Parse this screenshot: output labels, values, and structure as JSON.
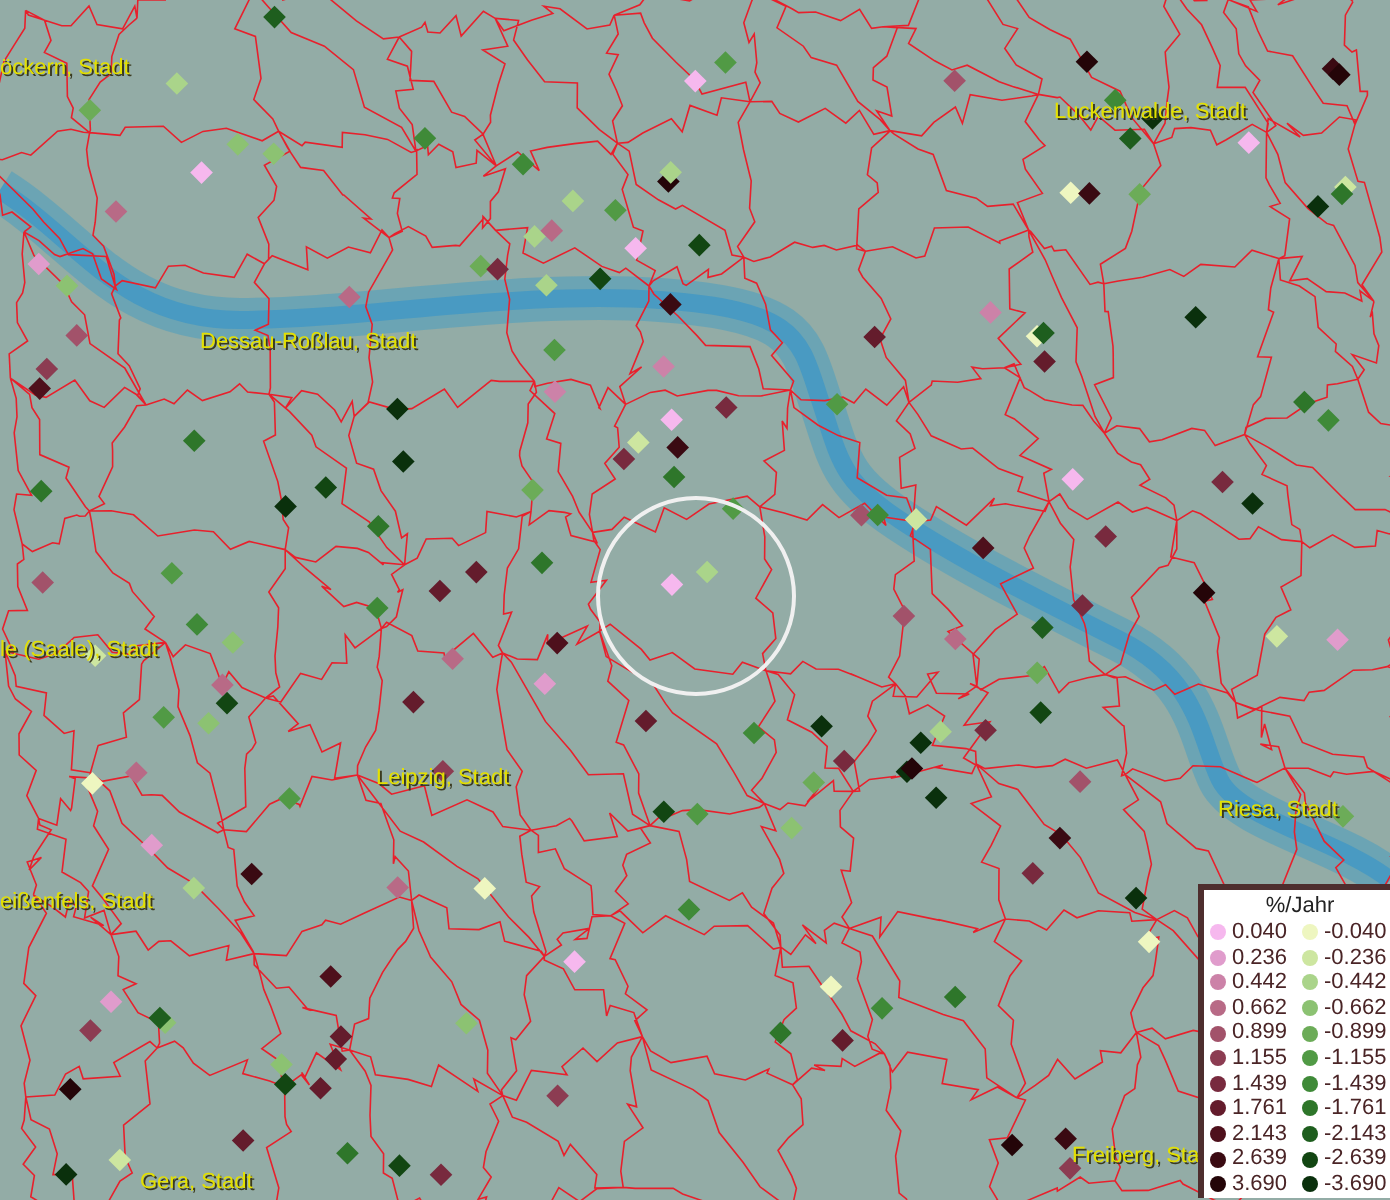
{
  "map": {
    "place_labels": [
      {
        "text": "öckern, Stadt"
      },
      {
        "text": "Luckenwalde, Stadt"
      },
      {
        "text": "Dessau-Roßlau, Stadt"
      },
      {
        "text": "le (Saale), Stadt"
      },
      {
        "text": "Leipzig, Stadt"
      },
      {
        "text": "eißenfels, Stadt"
      },
      {
        "text": "Riesa, Stadt"
      },
      {
        "text": "Freiberg, Sta"
      },
      {
        "text": "Gera, Stadt"
      }
    ]
  },
  "legend": {
    "title": "%/Jahr",
    "entries": [
      {
        "label": "0.040",
        "color": "#f6b8ee"
      },
      {
        "label": "-0.040",
        "color": "#eef6c0"
      },
      {
        "label": "0.236",
        "color": "#e09ccc"
      },
      {
        "label": "-0.236",
        "color": "#cde6a0"
      },
      {
        "label": "0.442",
        "color": "#cc82a8"
      },
      {
        "label": "-0.442",
        "color": "#aad48a"
      },
      {
        "label": "0.662",
        "color": "#b86a86"
      },
      {
        "label": "-0.662",
        "color": "#8cc272"
      },
      {
        "label": "0.899",
        "color": "#a2526a"
      },
      {
        "label": "-0.899",
        "color": "#6cac58"
      },
      {
        "label": "1.155",
        "color": "#8c3c52"
      },
      {
        "label": "-1.155",
        "color": "#519a45"
      },
      {
        "label": "1.439",
        "color": "#782a3e"
      },
      {
        "label": "-1.439",
        "color": "#3f8a38"
      },
      {
        "label": "1.761",
        "color": "#641c2c"
      },
      {
        "label": "-1.761",
        "color": "#2e762a"
      },
      {
        "label": "2.143",
        "color": "#4e101c"
      },
      {
        "label": "-2.143",
        "color": "#1e5e1e"
      },
      {
        "label": "2.639",
        "color": "#3a0a12"
      },
      {
        "label": "-2.639",
        "color": "#124612"
      },
      {
        "label": "3.690",
        "color": "#240508"
      },
      {
        "label": "-3.690",
        "color": "#0a300c"
      }
    ]
  }
}
